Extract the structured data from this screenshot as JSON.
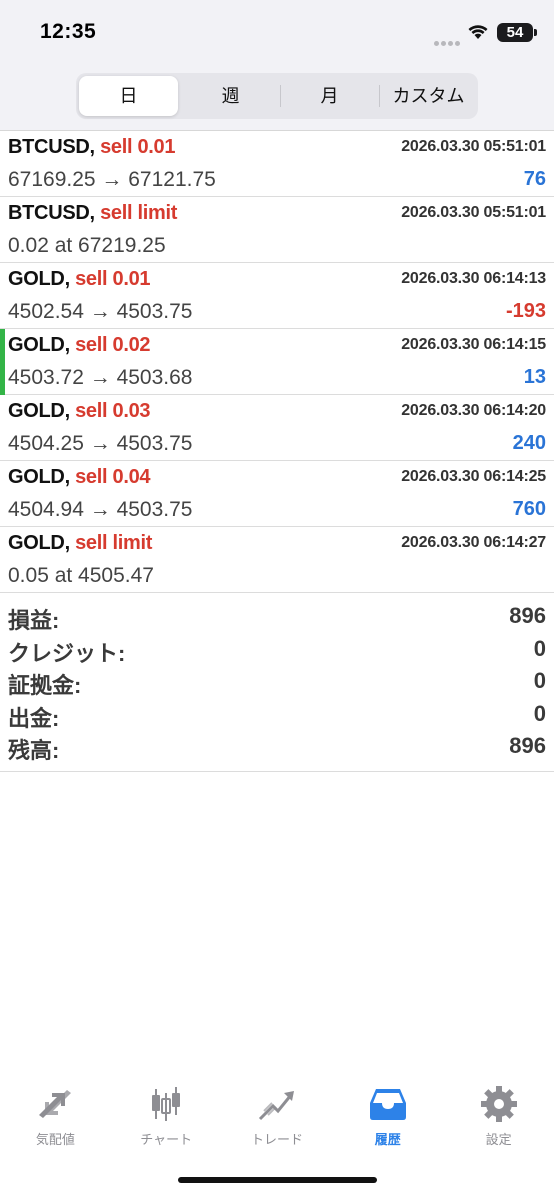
{
  "status": {
    "time": "12:35",
    "battery": "54"
  },
  "segments": [
    {
      "label": "日",
      "active": true
    },
    {
      "label": "週",
      "active": false
    },
    {
      "label": "月",
      "active": false
    },
    {
      "label": "カスタム",
      "active": false
    }
  ],
  "deals": [
    {
      "symbol": "BTCUSD,",
      "type": "sell 0.01",
      "time": "2026.03.30 05:51:01",
      "detail": "67169.25 → 67121.75",
      "profit": "76"
    },
    {
      "symbol": "BTCUSD,",
      "type": "sell limit",
      "time": "2026.03.30 05:51:01",
      "detail": "0.02 at 67219.25",
      "profit": ""
    },
    {
      "symbol": "GOLD,",
      "type": "sell 0.01",
      "time": "2026.03.30 06:14:13",
      "detail": "4502.54 → 4503.75",
      "profit": "-193"
    },
    {
      "symbol": "GOLD,",
      "type": "sell 0.02",
      "time": "2026.03.30 06:14:15",
      "detail": "4503.72 → 4503.68",
      "profit": "13"
    },
    {
      "symbol": "GOLD,",
      "type": "sell 0.03",
      "time": "2026.03.30 06:14:20",
      "detail": "4504.25 → 4503.75",
      "profit": "240"
    },
    {
      "symbol": "GOLD,",
      "type": "sell 0.04",
      "time": "2026.03.30 06:14:25",
      "detail": "4504.94 → 4503.75",
      "profit": "760"
    },
    {
      "symbol": "GOLD,",
      "type": "sell limit",
      "time": "2026.03.30 06:14:27",
      "detail": "0.05 at 4505.47",
      "profit": ""
    }
  ],
  "summary": [
    {
      "label": "損益:",
      "value": "896"
    },
    {
      "label": "クレジット:",
      "value": "0"
    },
    {
      "label": "証拠金:",
      "value": "0"
    },
    {
      "label": "出金:",
      "value": "0"
    },
    {
      "label": "残高:",
      "value": "896"
    }
  ],
  "tabs": [
    {
      "label": "気配値",
      "icon": "quotes-arrows-icon",
      "active": false
    },
    {
      "label": "チャート",
      "icon": "candlestick-chart-icon",
      "active": false
    },
    {
      "label": "トレード",
      "icon": "trade-trend-icon",
      "active": false
    },
    {
      "label": "履歴",
      "icon": "history-inbox-icon",
      "active": true
    },
    {
      "label": "設定",
      "icon": "gear-icon",
      "active": false
    }
  ],
  "colors": {
    "sell": "#d63b2f",
    "profit_positive": "#2a74d6",
    "profit_negative": "#d63b2f",
    "selected_marker": "#33b447",
    "tab_active": "#2d82e8",
    "tab_inactive": "#8e8e93"
  }
}
